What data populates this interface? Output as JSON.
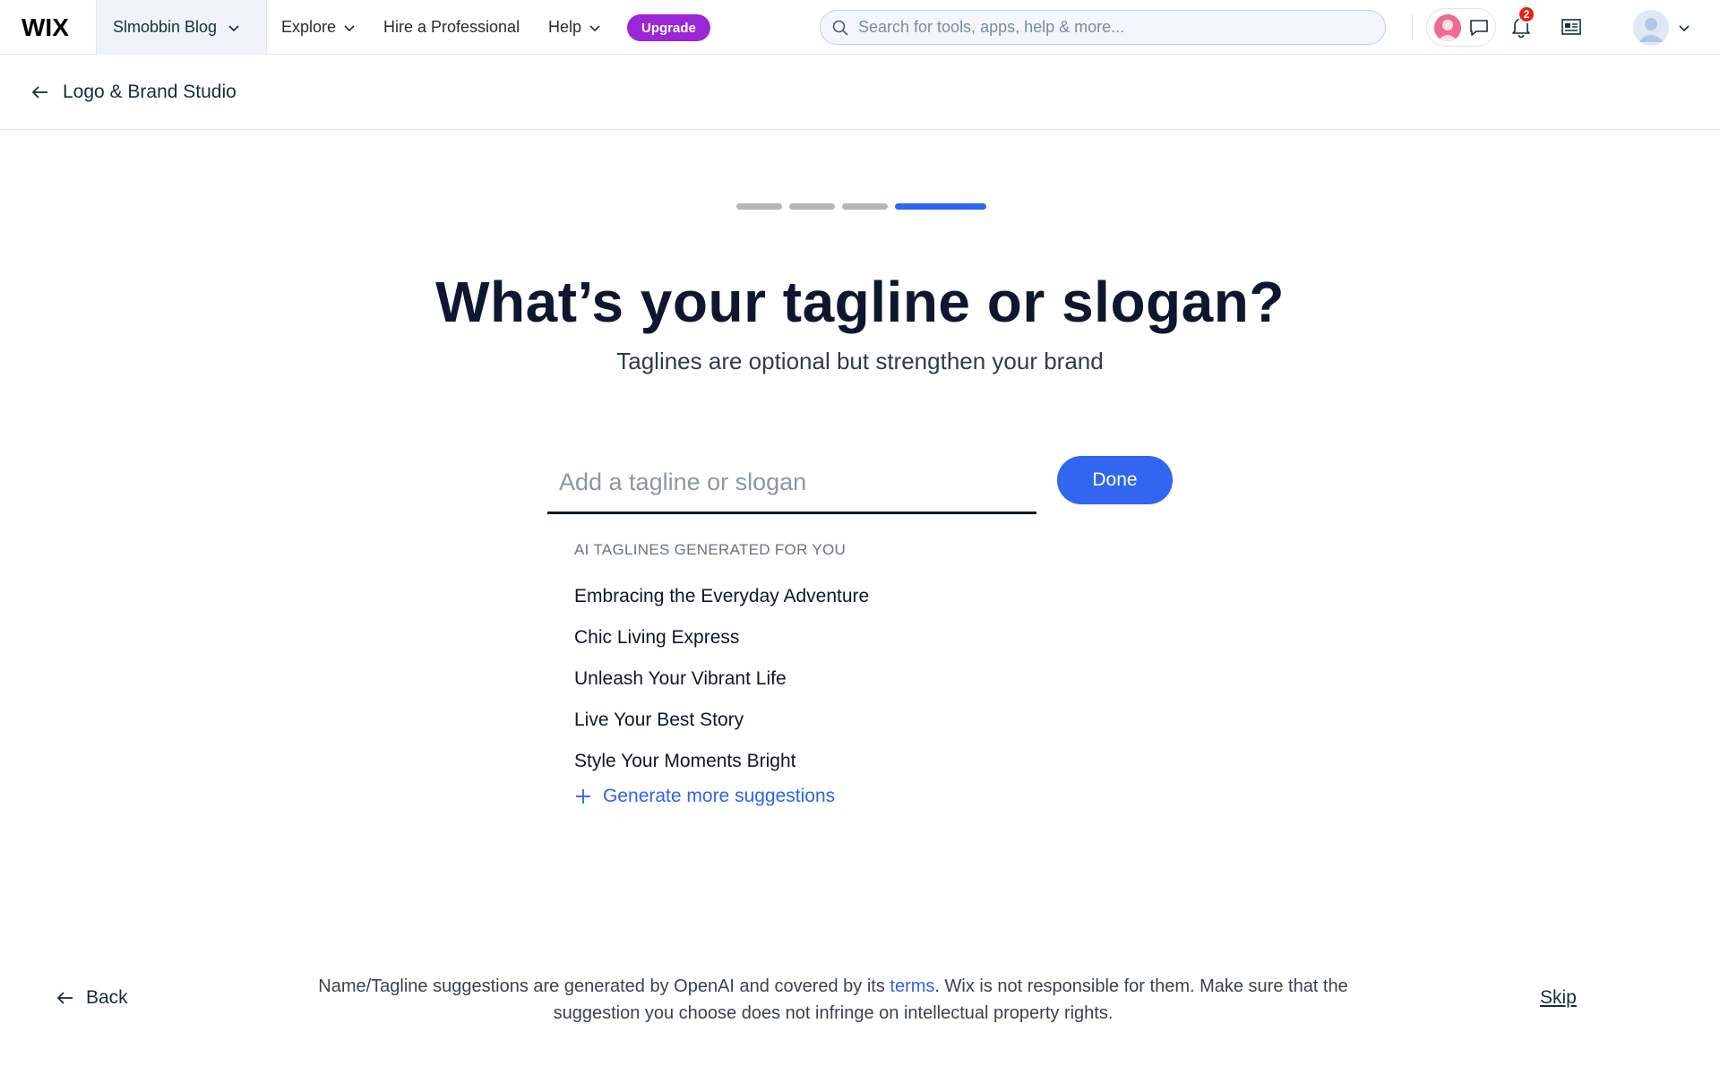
{
  "topbar": {
    "logo_text": "WIX",
    "site_name": "Slmobbin Blog",
    "nav": {
      "explore": "Explore",
      "hire": "Hire a Professional",
      "help": "Help"
    },
    "upgrade_label": "Upgrade",
    "search_placeholder": "Search for tools, apps, help & more...",
    "notification_count": "2",
    "icons": [
      "wix-logo",
      "chevron-down-icon",
      "search-icon",
      "chat-icon",
      "bell-icon",
      "news-icon",
      "user-avatar-icon"
    ],
    "colors": {
      "upgrade": "#9a27d5",
      "badge": "#e62214"
    }
  },
  "subheader": {
    "back_label": "Logo & Brand Studio"
  },
  "progress": {
    "total_steps": 4,
    "current_step": 4,
    "colors": {
      "active": "#3166f0",
      "inactive": "#b6b6b6"
    }
  },
  "main": {
    "title": "What’s your tagline or slogan?",
    "subtitle": "Taglines are optional but strengthen your brand",
    "input_placeholder": "Add a tagline or slogan",
    "input_value": "",
    "done_label": "Done",
    "ai_heading": "AI TAGLINES GENERATED FOR YOU",
    "suggestions": [
      "Embracing the Everyday Adventure",
      "Chic Living Express",
      "Unleash Your Vibrant Life",
      "Live Your Best Story",
      "Style Your Moments Bright"
    ],
    "generate_label": "Generate more suggestions",
    "accent_color": "#3166f0"
  },
  "footer": {
    "back_label": "Back",
    "disclaimer_before": "Name/Tagline suggestions are generated by OpenAI and covered by its ",
    "disclaimer_link": "terms",
    "disclaimer_after": ". Wix is not responsible for them. Make sure that the suggestion you choose does not infringe on intellectual property rights.",
    "skip_label": "Skip"
  }
}
